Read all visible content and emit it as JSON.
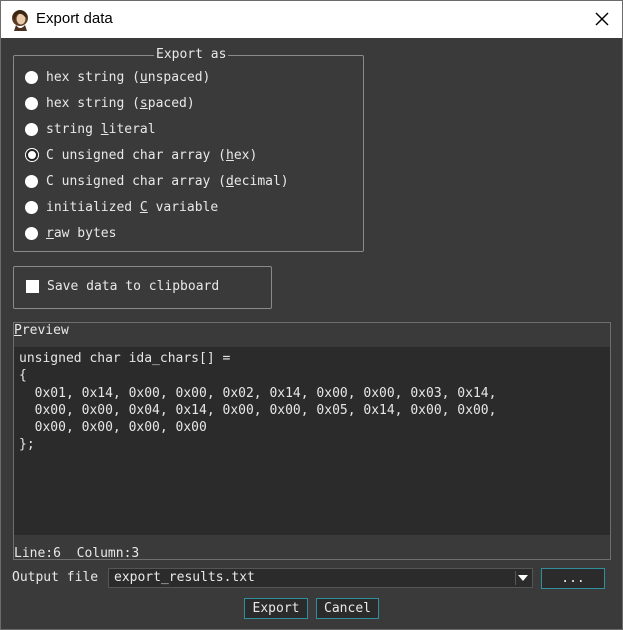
{
  "window": {
    "title": "Export data"
  },
  "export_as": {
    "legend": "Export as",
    "options": [
      {
        "pre": "hex string (",
        "key": "u",
        "post": "nspaced)",
        "selected": false
      },
      {
        "pre": "hex string (",
        "key": "s",
        "post": "paced)",
        "selected": false
      },
      {
        "pre": "string ",
        "key": "l",
        "post": "iteral",
        "selected": false
      },
      {
        "pre": "C unsigned char array (",
        "key": "h",
        "post": "ex)",
        "selected": true
      },
      {
        "pre": "C unsigned char array (",
        "key": "d",
        "post": "ecimal)",
        "selected": false
      },
      {
        "pre": "initialized ",
        "key": "C",
        "post": " variable",
        "selected": false
      },
      {
        "pre": "",
        "key": "r",
        "post": "aw bytes",
        "selected": false
      }
    ]
  },
  "clipboard": {
    "label": "Save data to clipboard",
    "checked": false
  },
  "preview": {
    "label_key": "P",
    "label_rest": "review",
    "lines": [
      "unsigned char ida_chars[] =",
      "{",
      "  0x01, 0x14, 0x00, 0x00, 0x02, 0x14, 0x00, 0x00, 0x03, 0x14,",
      "  0x00, 0x00, 0x04, 0x14, 0x00, 0x00, 0x05, 0x14, 0x00, 0x00,",
      "  0x00, 0x00, 0x00, 0x00",
      "};"
    ],
    "status": "Line:6  Column:3"
  },
  "output": {
    "label": "Output file",
    "value": "export_results.txt",
    "browse_label": "..."
  },
  "buttons": {
    "export": "Export",
    "cancel": "Cancel"
  },
  "colors": {
    "background": "#3a3a3a",
    "editor_bg": "#2b2b2b",
    "focus_border": "#2f8f9a"
  }
}
